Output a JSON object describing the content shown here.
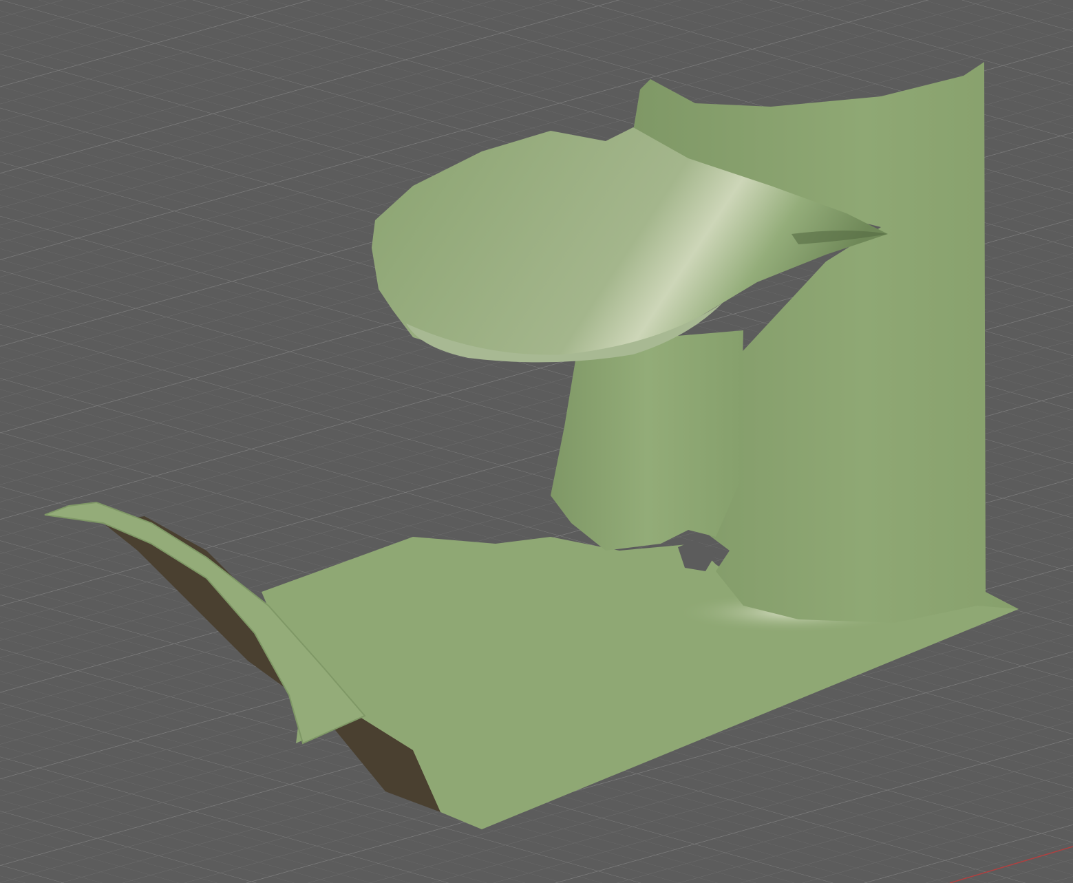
{
  "viewport": {
    "background_color": "#5c5c5c",
    "grid_minor_color": "#6a6a6a",
    "grid_major_color": "#767676",
    "axis_color": "#b04040"
  },
  "mesh": {
    "surface_color": "#8fa874",
    "highlight_color": "#c9d3b4",
    "shadow_color": "#6d8556",
    "underside_color": "#4a4030"
  }
}
